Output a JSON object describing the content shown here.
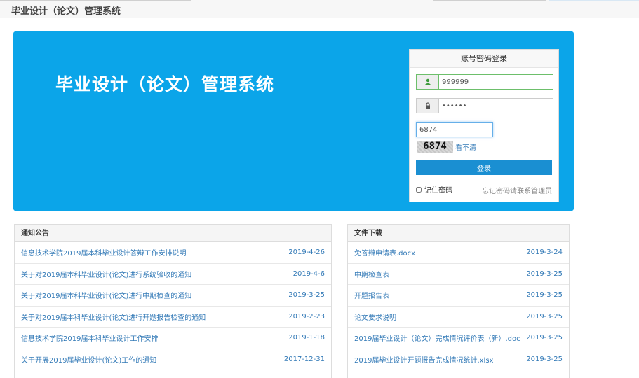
{
  "topbar": {
    "brand": "毕业设计（论文）管理系统"
  },
  "hero": {
    "title": "毕业设计（论文）管理系统"
  },
  "login": {
    "header": "账号密码登录",
    "username_value": "999999",
    "password_value": "••••••",
    "captcha_value": "6874",
    "captcha_image_text": "6874",
    "captcha_refresh": "看不清",
    "submit_label": "登录",
    "remember_label": "记住密码",
    "forgot_text": "忘记密码请联系管理员",
    "icons": {
      "user": "user-icon",
      "password": "lock-icon"
    }
  },
  "notices": {
    "header": "通知公告",
    "items": [
      {
        "title": "信息技术学院2019届本科毕业设计答辩工作安排说明",
        "date": "2019-4-26"
      },
      {
        "title": "关于对2019届本科毕业设计(论文)进行系统验收的通知",
        "date": "2019-4-6"
      },
      {
        "title": "关于对2019届本科毕业设计(论文)进行中期检查的通知",
        "date": "2019-3-25"
      },
      {
        "title": "关于对2019届本科毕业设计(论文)进行开题报告检查的通知",
        "date": "2019-2-23"
      },
      {
        "title": "信息技术学院2019届本科毕业设计工作安排",
        "date": "2019-1-18"
      },
      {
        "title": "关于开展2019届毕业设计(论文)工作的通知",
        "date": "2017-12-31"
      }
    ]
  },
  "files": {
    "header": "文件下载",
    "items": [
      {
        "title": "免答辩申请表.docx",
        "date": "2019-3-24"
      },
      {
        "title": "中期检查表",
        "date": "2019-3-25"
      },
      {
        "title": "开题报告表",
        "date": "2019-3-25"
      },
      {
        "title": "论文要求说明",
        "date": "2019-3-25"
      },
      {
        "title": "2019届毕业设计（论文）完成情况评价表（新）.doc",
        "date": "2019-3-25"
      },
      {
        "title": "2019届毕业设计开题报告完成情况统计.xlsx",
        "date": "2019-3-25"
      }
    ]
  },
  "colors": {
    "hero": "#0ba5e9",
    "button": "#1a8fd2",
    "link": "#337ab7"
  }
}
